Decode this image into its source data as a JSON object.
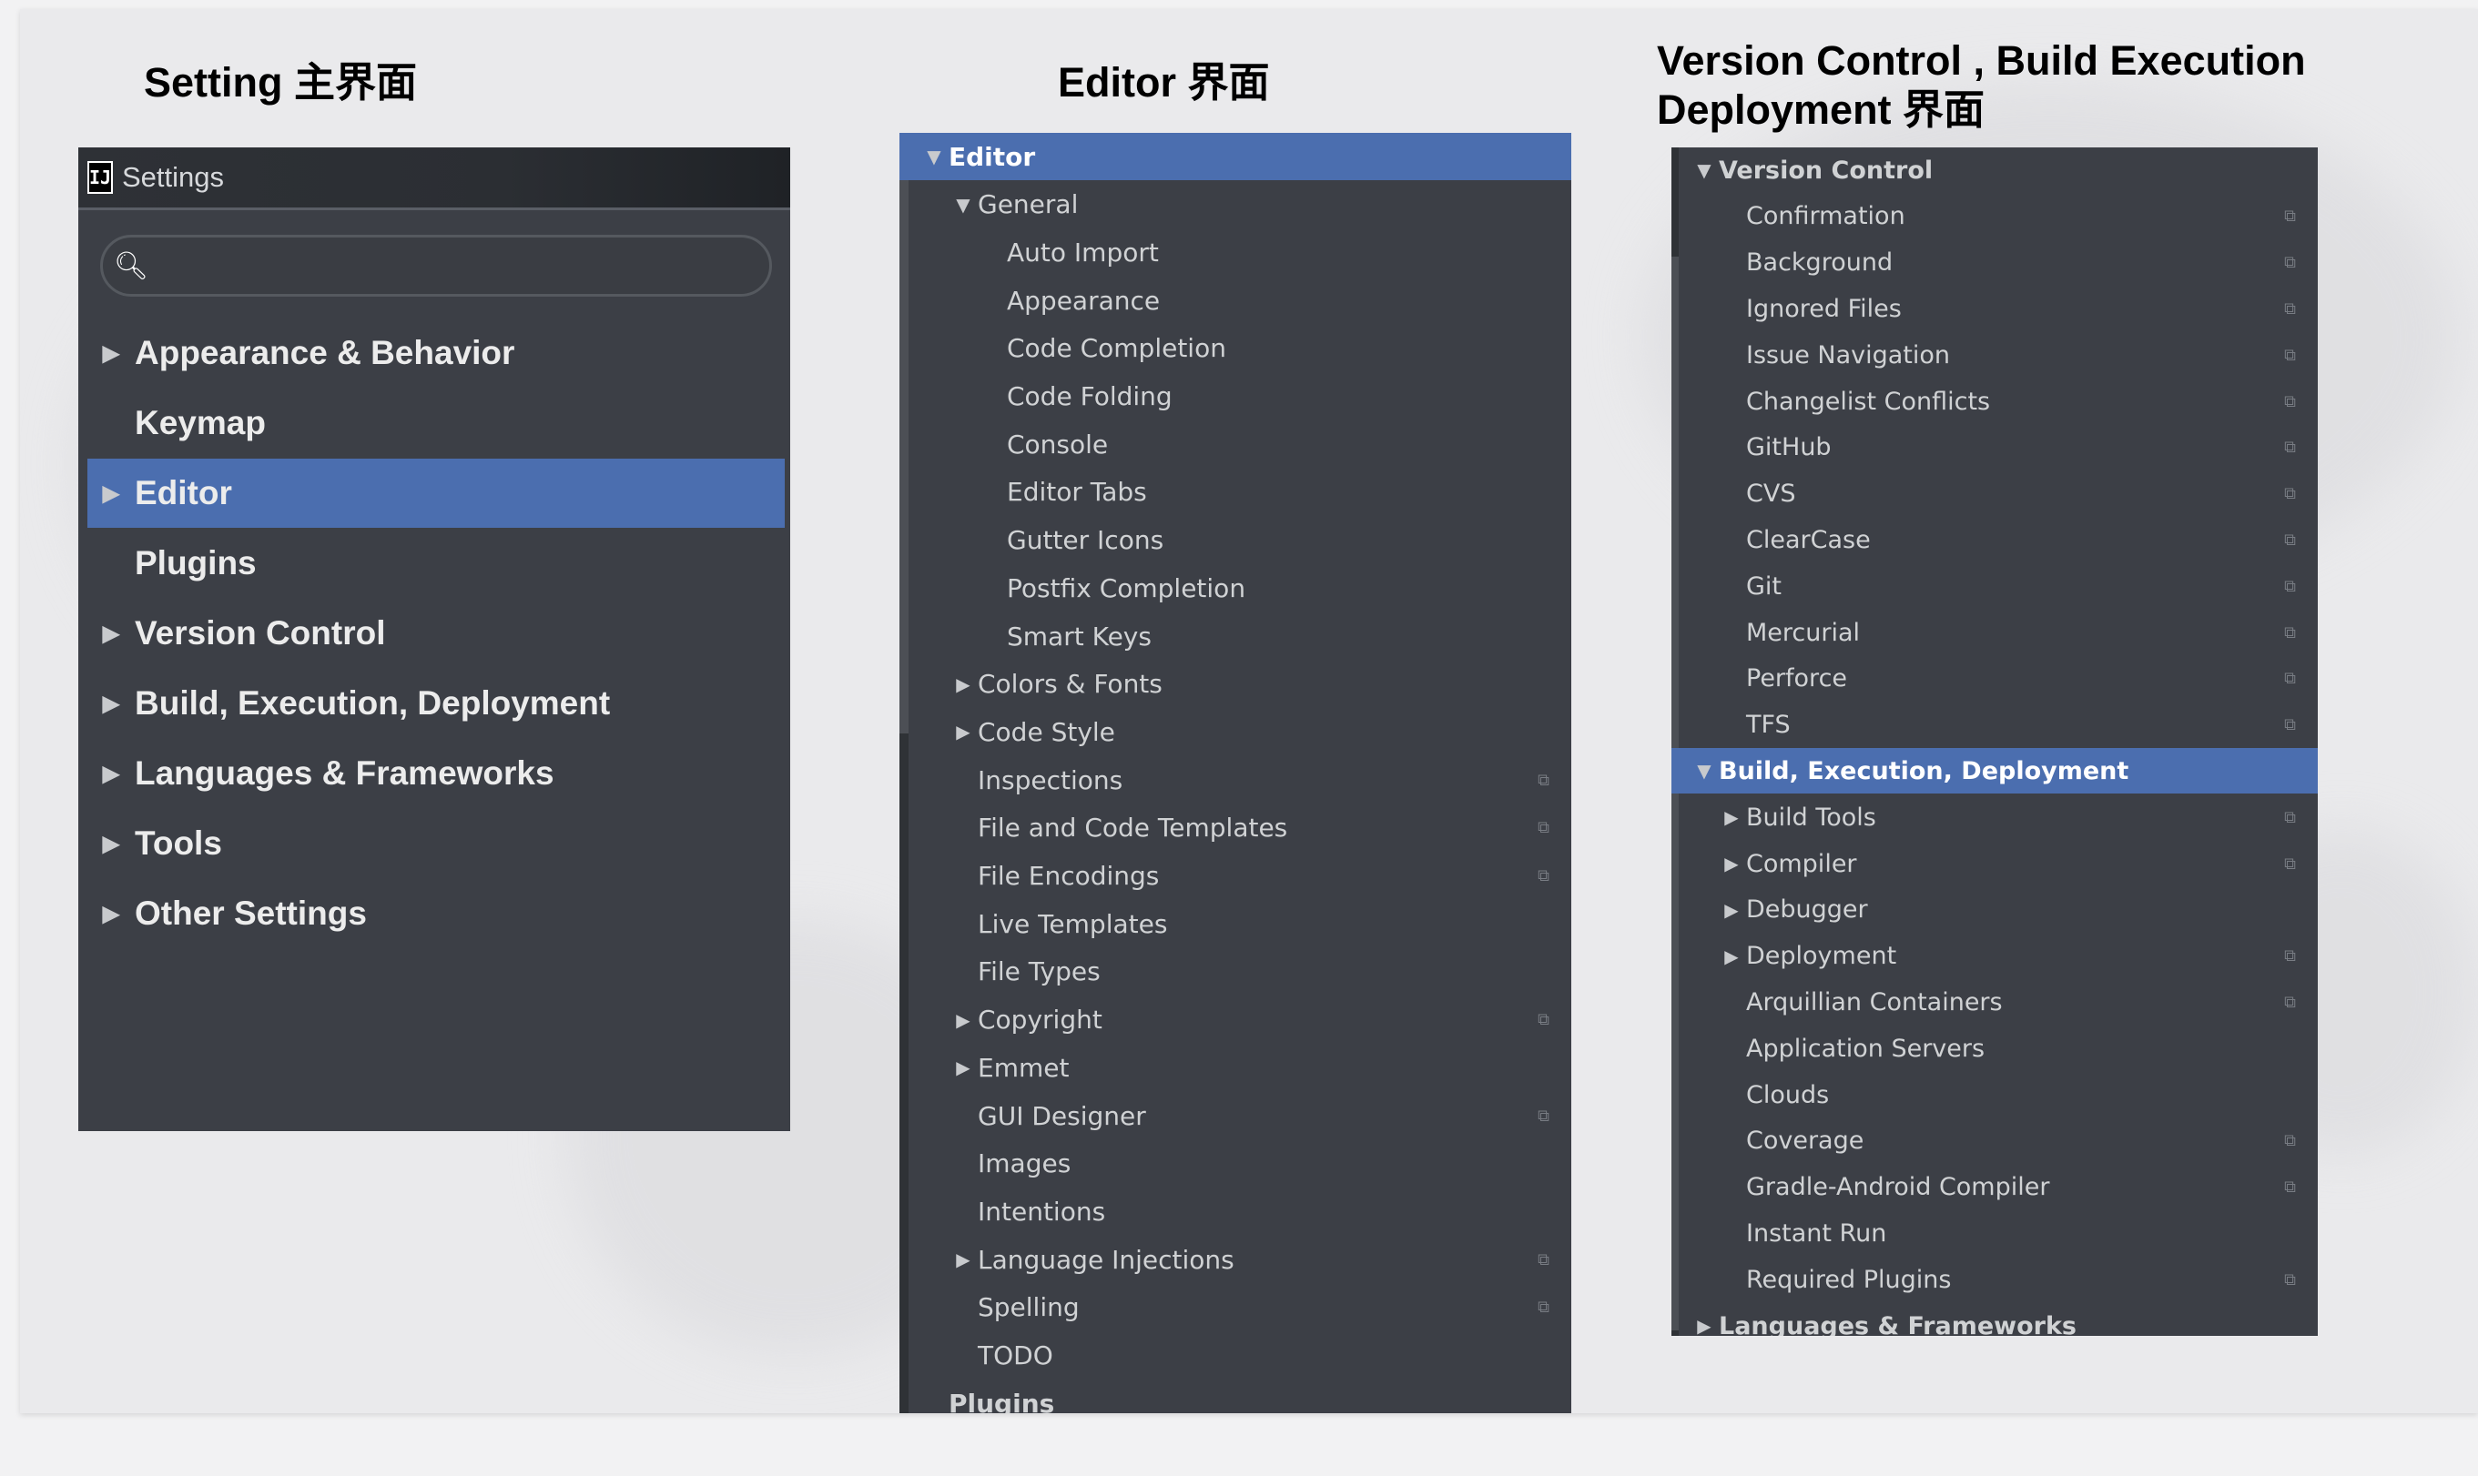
{
  "headings": {
    "settings": "Setting 主界面",
    "editor": "Editor 界面",
    "vc_line1": "Version Control , Build Execution",
    "vc_line2": "Deployment 界面"
  },
  "settings_window": {
    "title": "Settings",
    "logo": "IJ",
    "search_placeholder": "",
    "items": [
      {
        "label": "Appearance & Behavior",
        "expandable": true,
        "selected": false
      },
      {
        "label": "Keymap",
        "expandable": false,
        "selected": false
      },
      {
        "label": "Editor",
        "expandable": true,
        "selected": true
      },
      {
        "label": "Plugins",
        "expandable": false,
        "selected": false
      },
      {
        "label": "Version Control",
        "expandable": true,
        "selected": false
      },
      {
        "label": "Build, Execution, Deployment",
        "expandable": true,
        "selected": false
      },
      {
        "label": "Languages & Frameworks",
        "expandable": true,
        "selected": false
      },
      {
        "label": "Tools",
        "expandable": true,
        "selected": false
      },
      {
        "label": "Other Settings",
        "expandable": true,
        "selected": false
      }
    ]
  },
  "editor_tree": {
    "rows": [
      {
        "label": "Editor",
        "level": 0,
        "caret": "open",
        "selected": true,
        "copy": false,
        "bold": true
      },
      {
        "label": "General",
        "level": 1,
        "caret": "open",
        "selected": false,
        "copy": false
      },
      {
        "label": "Auto Import",
        "level": 2,
        "caret": "none",
        "copy": false
      },
      {
        "label": "Appearance",
        "level": 2,
        "caret": "none",
        "copy": false
      },
      {
        "label": "Code Completion",
        "level": 2,
        "caret": "none",
        "copy": false
      },
      {
        "label": "Code Folding",
        "level": 2,
        "caret": "none",
        "copy": false
      },
      {
        "label": "Console",
        "level": 2,
        "caret": "none",
        "copy": false
      },
      {
        "label": "Editor Tabs",
        "level": 2,
        "caret": "none",
        "copy": false
      },
      {
        "label": "Gutter Icons",
        "level": 2,
        "caret": "none",
        "copy": false
      },
      {
        "label": "Postfix Completion",
        "level": 2,
        "caret": "none",
        "copy": false
      },
      {
        "label": "Smart Keys",
        "level": 2,
        "caret": "none",
        "copy": false
      },
      {
        "label": "Colors & Fonts",
        "level": 1,
        "caret": "closed",
        "copy": false
      },
      {
        "label": "Code Style",
        "level": 1,
        "caret": "closed",
        "copy": false
      },
      {
        "label": "Inspections",
        "level": 1,
        "caret": "none",
        "copy": true
      },
      {
        "label": "File and Code Templates",
        "level": 1,
        "caret": "none",
        "copy": true
      },
      {
        "label": "File Encodings",
        "level": 1,
        "caret": "none",
        "copy": true
      },
      {
        "label": "Live Templates",
        "level": 1,
        "caret": "none",
        "copy": false
      },
      {
        "label": "File Types",
        "level": 1,
        "caret": "none",
        "copy": false
      },
      {
        "label": "Copyright",
        "level": 1,
        "caret": "closed",
        "copy": true
      },
      {
        "label": "Emmet",
        "level": 1,
        "caret": "closed",
        "copy": false
      },
      {
        "label": "GUI Designer",
        "level": 1,
        "caret": "none",
        "copy": true
      },
      {
        "label": "Images",
        "level": 1,
        "caret": "none",
        "copy": false
      },
      {
        "label": "Intentions",
        "level": 1,
        "caret": "none",
        "copy": false
      },
      {
        "label": "Language Injections",
        "level": 1,
        "caret": "closed",
        "copy": true
      },
      {
        "label": "Spelling",
        "level": 1,
        "caret": "none",
        "copy": true
      },
      {
        "label": "TODO",
        "level": 1,
        "caret": "none",
        "copy": false
      },
      {
        "label": "Plugins",
        "level": 0,
        "caret": "none",
        "copy": false,
        "bold": true
      }
    ]
  },
  "vc_tree": {
    "rows": [
      {
        "label": "Version Control",
        "level": 0,
        "caret": "open",
        "selected": false,
        "copy": false,
        "bold": true
      },
      {
        "label": "Confirmation",
        "level": 1,
        "caret": "none",
        "copy": true
      },
      {
        "label": "Background",
        "level": 1,
        "caret": "none",
        "copy": true
      },
      {
        "label": "Ignored Files",
        "level": 1,
        "caret": "none",
        "copy": true
      },
      {
        "label": "Issue Navigation",
        "level": 1,
        "caret": "none",
        "copy": true
      },
      {
        "label": "Changelist Conflicts",
        "level": 1,
        "caret": "none",
        "copy": true
      },
      {
        "label": "GitHub",
        "level": 1,
        "caret": "none",
        "copy": true
      },
      {
        "label": "CVS",
        "level": 1,
        "caret": "none",
        "copy": true
      },
      {
        "label": "ClearCase",
        "level": 1,
        "caret": "none",
        "copy": true
      },
      {
        "label": "Git",
        "level": 1,
        "caret": "none",
        "copy": true
      },
      {
        "label": "Mercurial",
        "level": 1,
        "caret": "none",
        "copy": true
      },
      {
        "label": "Perforce",
        "level": 1,
        "caret": "none",
        "copy": true
      },
      {
        "label": "TFS",
        "level": 1,
        "caret": "none",
        "copy": true
      },
      {
        "label": "Build, Execution, Deployment",
        "level": 0,
        "caret": "open",
        "selected": true,
        "copy": false,
        "bold": true
      },
      {
        "label": "Build Tools",
        "level": 1,
        "caret": "closed",
        "copy": true
      },
      {
        "label": "Compiler",
        "level": 1,
        "caret": "closed",
        "copy": true
      },
      {
        "label": "Debugger",
        "level": 1,
        "caret": "closed",
        "copy": false
      },
      {
        "label": "Deployment",
        "level": 1,
        "caret": "closed",
        "copy": true
      },
      {
        "label": "Arquillian Containers",
        "level": 1,
        "caret": "none",
        "copy": true
      },
      {
        "label": "Application Servers",
        "level": 1,
        "caret": "none",
        "copy": false
      },
      {
        "label": "Clouds",
        "level": 1,
        "caret": "none",
        "copy": false
      },
      {
        "label": "Coverage",
        "level": 1,
        "caret": "none",
        "copy": true
      },
      {
        "label": "Gradle-Android Compiler",
        "level": 1,
        "caret": "none",
        "copy": true
      },
      {
        "label": "Instant Run",
        "level": 1,
        "caret": "none",
        "copy": false
      },
      {
        "label": "Required Plugins",
        "level": 1,
        "caret": "none",
        "copy": true
      },
      {
        "label": "Languages & Frameworks",
        "level": 0,
        "caret": "closed",
        "copy": false,
        "bold": true
      }
    ]
  },
  "icons": {
    "caret_open": "triangle-down-icon",
    "caret_closed": "triangle-right-icon",
    "copy": "copy-project-settings-icon",
    "search": "search-icon"
  },
  "colors": {
    "panel_bg": "#3c3f46",
    "selection": "#4b6eaf",
    "text": "#d0d2d4"
  }
}
